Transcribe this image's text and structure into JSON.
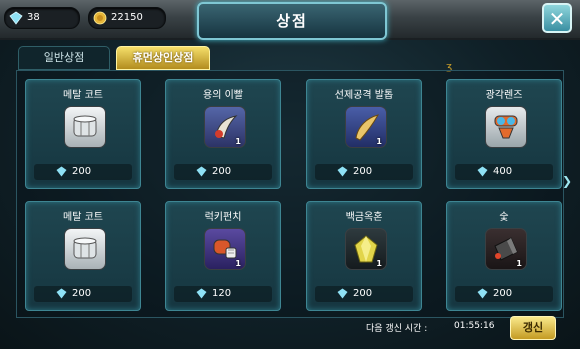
{
  "currency": {
    "gems": "38",
    "gold": "22150"
  },
  "header": {
    "title": "상점"
  },
  "tabs": [
    {
      "label": "일반상점"
    },
    {
      "label": "휴먼상인상점"
    }
  ],
  "marker": "ʒ",
  "items": [
    {
      "name": "메탈 코트",
      "price": "200",
      "qty": "",
      "icon": "metal-coat-icon"
    },
    {
      "name": "용의 이빨",
      "price": "200",
      "qty": "1",
      "icon": "dragon-tooth-icon"
    },
    {
      "name": "선제공격 발톱",
      "price": "200",
      "qty": "1",
      "icon": "claw-icon"
    },
    {
      "name": "광각렌즈",
      "price": "400",
      "qty": "",
      "icon": "lens-icon"
    },
    {
      "name": "메탈 코트",
      "price": "200",
      "qty": "",
      "icon": "metal-coat-icon"
    },
    {
      "name": "럭키펀치",
      "price": "120",
      "qty": "1",
      "icon": "lucky-punch-icon"
    },
    {
      "name": "백금옥혼",
      "price": "200",
      "qty": "1",
      "icon": "platinum-orb-icon"
    },
    {
      "name": "숯",
      "price": "200",
      "qty": "1",
      "icon": "charcoal-icon"
    }
  ],
  "footer": {
    "refresh_label": "다음 갱신 시간 :",
    "refresh_time": "01:55:16",
    "refresh_button": "갱신"
  },
  "colors": {
    "accent": "#45b7c9",
    "gold_tab": "#e0c24a",
    "card_border": "#3e8592"
  }
}
